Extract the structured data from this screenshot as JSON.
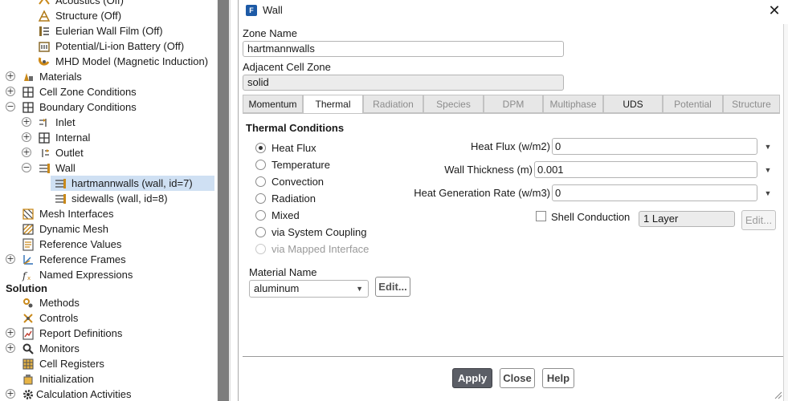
{
  "tree": {
    "items": [
      {
        "label": "Acoustics (Off)"
      },
      {
        "label": "Structure (Off)"
      },
      {
        "label": "Eulerian Wall Film (Off)"
      },
      {
        "label": "Potential/Li-ion Battery (Off)"
      },
      {
        "label": "MHD Model (Magnetic Induction)"
      },
      {
        "label": "Materials",
        "toggle": "+"
      },
      {
        "label": "Cell Zone Conditions",
        "toggle": "+"
      },
      {
        "label": "Boundary Conditions",
        "toggle": "−"
      },
      {
        "label": "Inlet",
        "toggle": "+"
      },
      {
        "label": "Internal",
        "toggle": "+"
      },
      {
        "label": "Outlet",
        "toggle": "+"
      },
      {
        "label": "Wall",
        "toggle": "−"
      },
      {
        "label": "hartmannwalls (wall, id=7)"
      },
      {
        "label": "sidewalls (wall, id=8)"
      },
      {
        "label": "Mesh Interfaces"
      },
      {
        "label": "Dynamic Mesh"
      },
      {
        "label": "Reference Values"
      },
      {
        "label": "Reference Frames",
        "toggle": "+"
      },
      {
        "label": "Named Expressions"
      },
      {
        "label": "Methods"
      },
      {
        "label": "Controls"
      },
      {
        "label": "Report Definitions",
        "toggle": "+"
      },
      {
        "label": "Monitors",
        "toggle": "+"
      },
      {
        "label": "Cell Registers"
      },
      {
        "label": "Initialization"
      },
      {
        "label": "Calculation Activities",
        "toggle": "+"
      }
    ],
    "section_solution": "Solution"
  },
  "dialog": {
    "title": "Wall",
    "icon_letter": "F",
    "close_symbol": "✕",
    "zone_name_label": "Zone Name",
    "zone_name_value": "hartmannwalls",
    "adjacent_label": "Adjacent Cell Zone",
    "adjacent_value": "solid",
    "tabs": [
      "Momentum",
      "Thermal",
      "Radiation",
      "Species",
      "DPM",
      "Multiphase",
      "UDS",
      "Potential",
      "Structure"
    ],
    "active_tab": "Thermal",
    "thermal": {
      "section_title": "Thermal Conditions",
      "options": [
        {
          "label": "Heat Flux",
          "selected": true
        },
        {
          "label": "Temperature"
        },
        {
          "label": "Convection"
        },
        {
          "label": "Radiation"
        },
        {
          "label": "Mixed"
        },
        {
          "label": "via System Coupling"
        },
        {
          "label": "via Mapped Interface",
          "disabled": true
        }
      ],
      "heat_flux_label": "Heat Flux (w/m2)",
      "heat_flux_value": "0",
      "wall_thickness_label": "Wall Thickness (m)",
      "wall_thickness_value": "0.001",
      "heat_gen_label": "Heat Generation Rate (w/m3)",
      "heat_gen_value": "0",
      "shell_conduction_label": "Shell Conduction",
      "shell_layers_value": "1 Layer",
      "shell_edit_label": "Edit...",
      "material_name_label": "Material Name",
      "material_value": "aluminum",
      "material_edit_label": "Edit..."
    },
    "buttons": {
      "apply": "Apply",
      "close": "Close",
      "help": "Help"
    }
  },
  "colors": {
    "selection": "#cfe0f3",
    "primary_button": "#5b5e66",
    "title_icon": "#1d5aa6"
  }
}
